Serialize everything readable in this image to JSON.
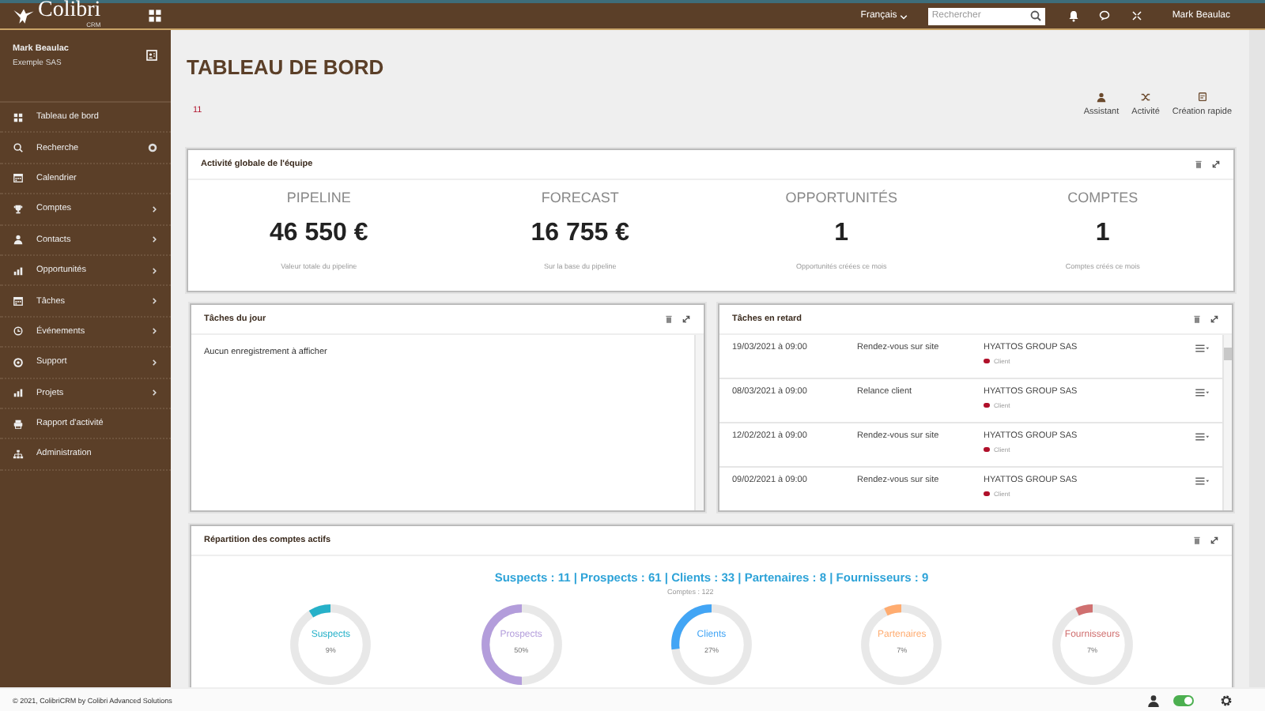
{
  "topbar": {
    "logo": "Colibri",
    "logo_sub": "CRM",
    "language": "Français",
    "search": {
      "placeholder": "Rechercher"
    },
    "user": "Mark Beaulac"
  },
  "sidebar": {
    "user": "Mark Beaulac",
    "company": "Exemple SAS",
    "items": [
      {
        "label": "Tableau de bord",
        "arrow": false,
        "badge": false
      },
      {
        "label": "Recherche",
        "arrow": false,
        "badge": true
      },
      {
        "label": "Calendrier",
        "arrow": false,
        "badge": false
      },
      {
        "label": "Comptes",
        "arrow": true,
        "badge": false
      },
      {
        "label": "Contacts",
        "arrow": true,
        "badge": false
      },
      {
        "label": "Opportunités",
        "arrow": true,
        "badge": false
      },
      {
        "label": "Tâches",
        "arrow": true,
        "badge": false
      },
      {
        "label": "Événements",
        "arrow": true,
        "badge": false
      },
      {
        "label": "Support",
        "arrow": true,
        "badge": false
      },
      {
        "label": "Projets",
        "arrow": true,
        "badge": false
      },
      {
        "label": "Rapport d'activité",
        "arrow": false,
        "badge": false
      },
      {
        "label": "Administration",
        "arrow": false,
        "badge": false
      }
    ]
  },
  "page": {
    "title": "TABLEAU DE BORD",
    "counter": "11",
    "actions": [
      {
        "label": "Assistant"
      },
      {
        "label": "Activité"
      },
      {
        "label": "Création rapide"
      }
    ]
  },
  "activity": {
    "title": "Activité globale de l'équipe",
    "stats": [
      {
        "label": "PIPELINE",
        "value": "46 550 €",
        "caption": "Valeur totale du pipeline"
      },
      {
        "label": "FORECAST",
        "value": "16 755 €",
        "caption": "Sur la base du pipeline"
      },
      {
        "label": "OPPORTUNITÉS",
        "value": "1",
        "caption": "Opportunités créées ce mois"
      },
      {
        "label": "COMPTES",
        "value": "1",
        "caption": "Comptes créés ce mois"
      }
    ]
  },
  "today_tasks": {
    "title": "Tâches du jour",
    "empty": "Aucun enregistrement à afficher"
  },
  "late_tasks": {
    "title": "Tâches en retard",
    "rows": [
      {
        "date": "19/03/2021 à 09:00",
        "subject": "Rendez-vous sur site",
        "company": "HYATTOS GROUP SAS",
        "tag": "Client",
        "color": "#b0102a"
      },
      {
        "date": "08/03/2021 à 09:00",
        "subject": "Relance client",
        "company": "HYATTOS GROUP SAS",
        "tag": "Client",
        "color": "#b0102a"
      },
      {
        "date": "12/02/2021 à 09:00",
        "subject": "Rendez-vous sur site",
        "company": "HYATTOS GROUP SAS",
        "tag": "Client",
        "color": "#b0102a"
      },
      {
        "date": "09/02/2021 à 09:00",
        "subject": "Rendez-vous sur site",
        "company": "HYATTOS GROUP SAS",
        "tag": "Client",
        "color": "#b0102a"
      }
    ]
  },
  "accounts": {
    "title": "Répartition des comptes actifs",
    "summary": "Suspects : 11 | Prospects : 61 | Clients : 33 | Partenaires : 8 | Fournisseurs : 9",
    "total": "Comptes : 122",
    "items": [
      {
        "label": "Suspects",
        "percent": "9%",
        "level": 0.09,
        "color": "#26b1c9"
      },
      {
        "label": "Prospects",
        "percent": "50%",
        "level": 0.5,
        "color": "#b39ddb"
      },
      {
        "label": "Clients",
        "percent": "27%",
        "level": 0.27,
        "color": "#42a5f5"
      },
      {
        "label": "Partenaires",
        "percent": "7%",
        "level": 0.07,
        "color": "#ffac70"
      },
      {
        "label": "Fournisseurs",
        "percent": "7%",
        "level": 0.07,
        "color": "#d07070"
      }
    ]
  },
  "footer": {
    "copyright": "© 2021, ColibriCRM by Colibri Advanced Solutions",
    "toggle": {
      "on": true
    }
  }
}
